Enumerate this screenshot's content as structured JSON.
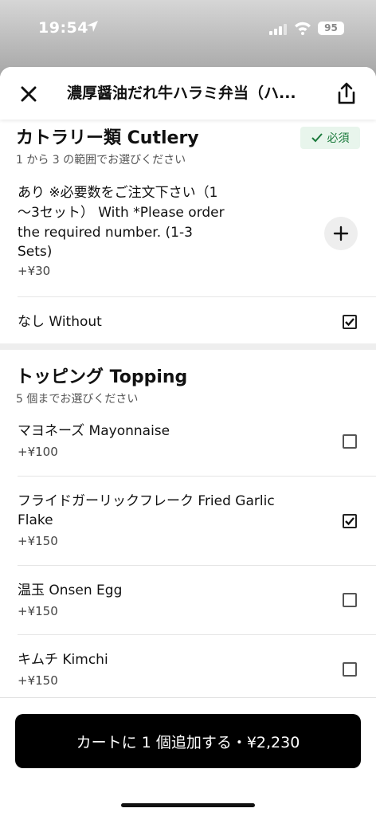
{
  "status_bar": {
    "time": "19:54",
    "battery": "95"
  },
  "header": {
    "title": "濃厚醤油だれ牛ハラミ弁当（ハ..."
  },
  "sections": [
    {
      "title": "カトラリー類 Cutlery",
      "subtitle": "1 から 3 の範囲でお選びください",
      "badge": "必須",
      "options": [
        {
          "name_lines": [
            "あり ※必要数をご注文下さい（1",
            "〜3セット） With *Please order",
            "the required number. (1-3",
            "Sets)"
          ],
          "price": "+¥30",
          "control": "stepper"
        },
        {
          "name_lines": [
            "なし Without"
          ],
          "price": "",
          "control": "checkbox",
          "checked": true
        }
      ]
    },
    {
      "title": "トッピング Topping",
      "subtitle": "5 個までお選びください",
      "options": [
        {
          "name_lines": [
            "マヨネーズ Mayonnaise"
          ],
          "price": "+¥100",
          "checked": false
        },
        {
          "name_lines": [
            "フライドガーリックフレーク Fried Garlic",
            "Flake"
          ],
          "price": "+¥150",
          "checked": true
        },
        {
          "name_lines": [
            "温玉 Onsen Egg"
          ],
          "price": "+¥150",
          "checked": false
        },
        {
          "name_lines": [
            "キムチ Kimchi"
          ],
          "price": "+¥150",
          "checked": false
        }
      ]
    }
  ],
  "footer": {
    "cart_button": "カートに 1 個追加する・¥2,230"
  },
  "colors": {
    "badge_bg": "#e8f5ec",
    "badge_text": "#1b7a3c",
    "button_bg": "#000000"
  }
}
